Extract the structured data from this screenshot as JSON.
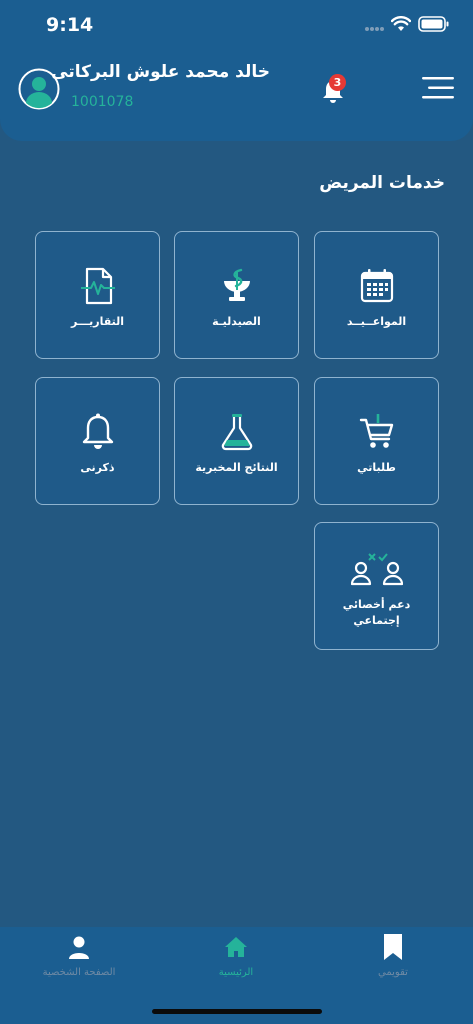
{
  "status_bar": {
    "time": "9:14"
  },
  "header": {
    "user_name": "خالد محمد علوش البركاتى",
    "user_id": "1001078",
    "notification_count": "3"
  },
  "services": {
    "title": "خدمات المريض",
    "tiles": [
      {
        "label": "المواعــيــد",
        "icon": "calendar-icon"
      },
      {
        "label": "الصيدليـة",
        "icon": "pharmacy-icon"
      },
      {
        "label": "التقاريـــر",
        "icon": "report-icon"
      },
      {
        "label": "طلباتي",
        "icon": "cart-icon"
      },
      {
        "label": "النتائج المخبرية",
        "icon": "flask-icon"
      },
      {
        "label": "ذكرنى",
        "icon": "bell-icon"
      },
      {
        "label_line1": "دعم أخصائي",
        "label_line2": "إجتماعي",
        "icon": "social-support-icon"
      }
    ]
  },
  "bottom_nav": {
    "items": [
      {
        "label": "الصفحة الشخصية",
        "icon": "person-icon"
      },
      {
        "label": "الرئيسية",
        "icon": "home-icon",
        "active": true
      },
      {
        "label": "تقويمي",
        "icon": "bookmark-icon"
      }
    ]
  },
  "colors": {
    "background": "#235881",
    "header": "#1b5e91",
    "accent": "#25b39a",
    "badge": "#e53935",
    "inactive_nav": "#6f8aa4"
  }
}
